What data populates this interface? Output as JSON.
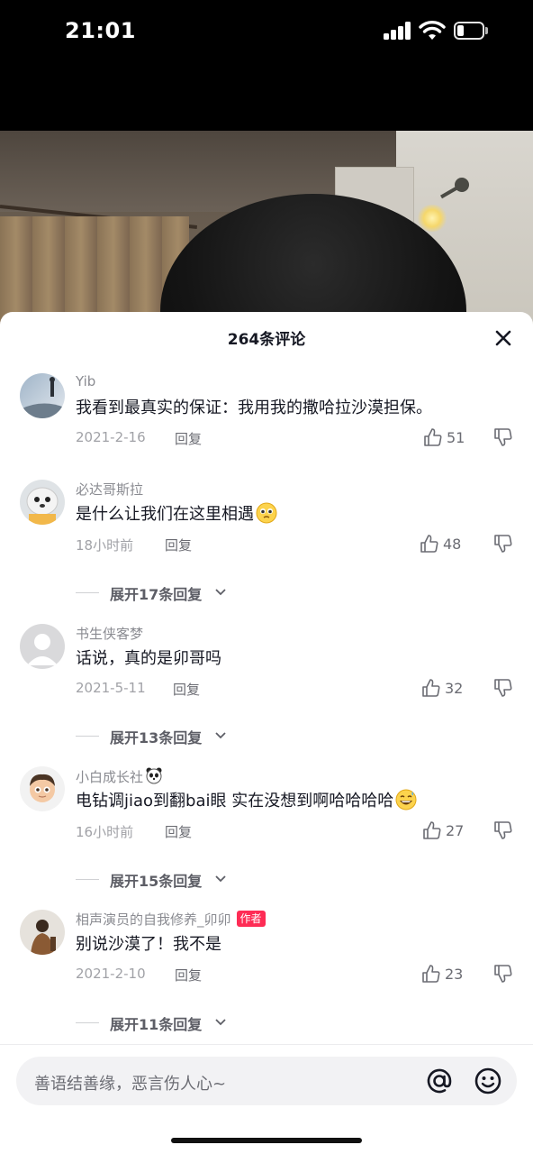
{
  "status_bar": {
    "time": "21:01"
  },
  "panel": {
    "title": "264条评论"
  },
  "comments": [
    {
      "username": "Yib",
      "text": "我看到最真实的保证：我用我的撒哈拉沙漠担保。",
      "date": "2021-2-16",
      "reply_label": "回复",
      "likes": "51",
      "expand_label": ""
    },
    {
      "username": "必达哥斯拉",
      "text": "是什么让我们在这里相遇",
      "emoji": "pleading-face-emoji",
      "date": "18小时前",
      "reply_label": "回复",
      "likes": "48",
      "expand_label": "展开17条回复"
    },
    {
      "username": "书生侠客梦",
      "text": "话说，真的是卯哥吗",
      "date": "2021-5-11",
      "reply_label": "回复",
      "likes": "32",
      "expand_label": "展开13条回复"
    },
    {
      "username": "小白成长社",
      "username_emoji": "panda-emoji",
      "text": "电钻调jiao到翻bai眼 实在没想到啊哈哈哈哈",
      "emoji": "grinning-sweat-emoji",
      "date": "16小时前",
      "reply_label": "回复",
      "likes": "27",
      "expand_label": "展开15条回复"
    },
    {
      "username": "相声演员的自我修养_卯卯",
      "badge": "作者",
      "text": "别说沙漠了！我不是",
      "date": "2021-2-10",
      "reply_label": "回复",
      "likes": "23",
      "expand_label": "展开11条回复"
    }
  ],
  "input": {
    "placeholder": "善语结善缘，恶言伤人心~"
  },
  "icons": [
    "signal-icon",
    "wifi-icon",
    "battery-icon",
    "close-icon",
    "like-icon",
    "dislike-icon",
    "chevron-down-icon",
    "at-icon",
    "emoji-icon"
  ],
  "colors": {
    "accent": "#fe2c55",
    "text": "#161823",
    "secondary": "#8a8b91"
  }
}
